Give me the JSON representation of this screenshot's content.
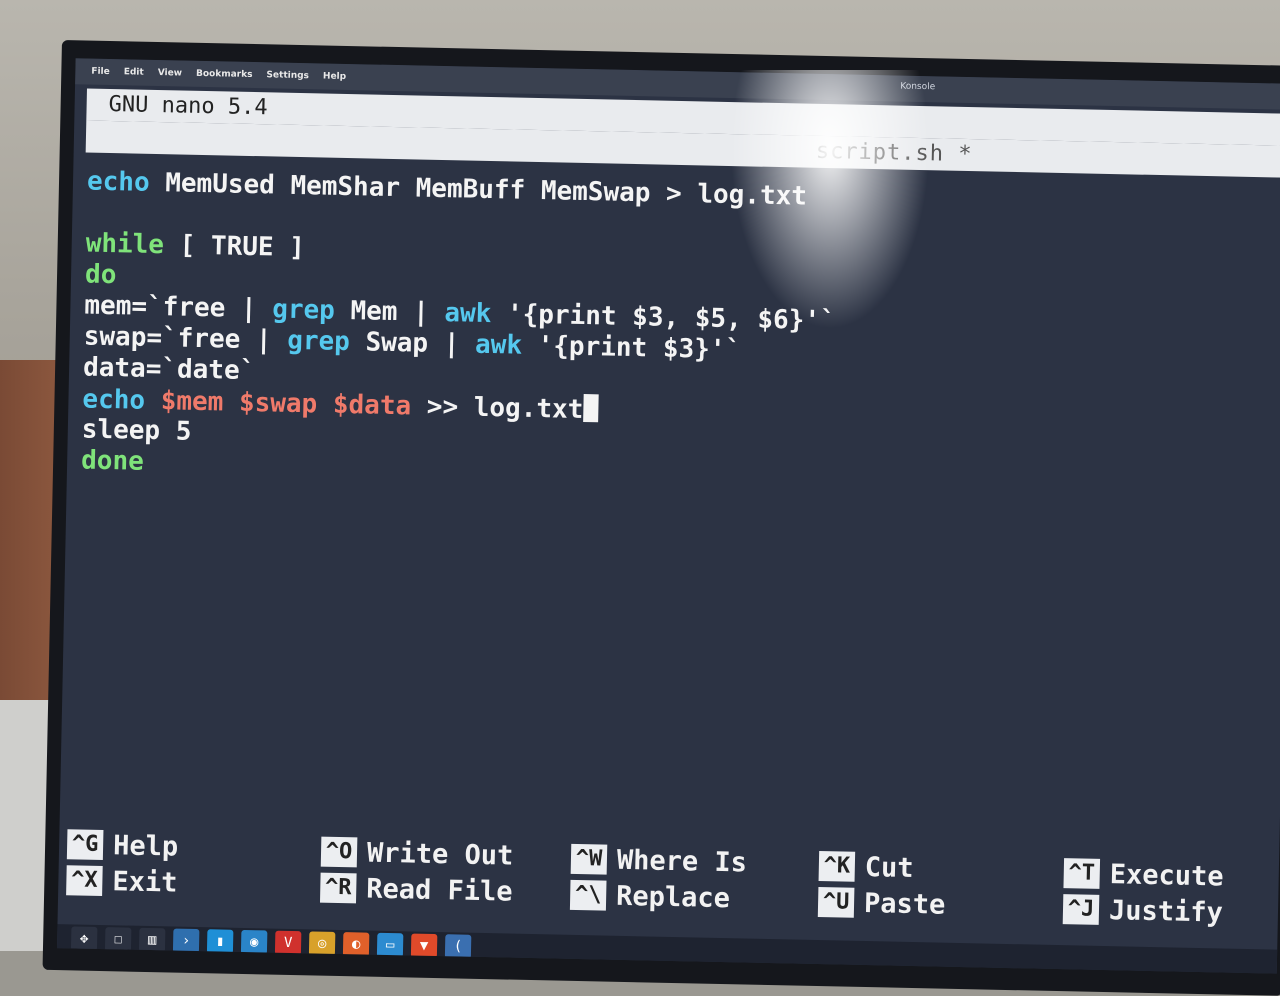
{
  "menu": {
    "items": [
      "File",
      "Edit",
      "View",
      "Bookmarks",
      "Settings",
      "Help"
    ],
    "window_title": "Konsole"
  },
  "title_bar": {
    "app_name": "GNU nano 5.4",
    "file_name": "script.sh *"
  },
  "editor": {
    "lines": [
      [
        {
          "t": "echo",
          "c": "kw"
        },
        {
          "t": " MemUsed MemShar MemBuff MemSwap > log.txt",
          "c": "wht"
        }
      ],
      [],
      [
        {
          "t": "while",
          "c": "ctl"
        },
        {
          "t": " [ TRUE ]",
          "c": "wht"
        }
      ],
      [
        {
          "t": "do",
          "c": "ctl"
        }
      ],
      [
        {
          "t": "mem=`free | ",
          "c": "wht"
        },
        {
          "t": "grep",
          "c": "kw"
        },
        {
          "t": " Mem | ",
          "c": "wht"
        },
        {
          "t": "awk",
          "c": "kw"
        },
        {
          "t": " '{print $3, $5, $6}'`",
          "c": "wht"
        }
      ],
      [
        {
          "t": "swap=`free | ",
          "c": "wht"
        },
        {
          "t": "grep",
          "c": "kw"
        },
        {
          "t": " Swap | ",
          "c": "wht"
        },
        {
          "t": "awk",
          "c": "kw"
        },
        {
          "t": " '{print $3}'`",
          "c": "wht"
        }
      ],
      [
        {
          "t": "data=`date`",
          "c": "wht"
        }
      ],
      [
        {
          "t": "echo",
          "c": "kw"
        },
        {
          "t": " ",
          "c": "wht"
        },
        {
          "t": "$mem",
          "c": "var"
        },
        {
          "t": " ",
          "c": "wht"
        },
        {
          "t": "$swap",
          "c": "var"
        },
        {
          "t": " ",
          "c": "wht"
        },
        {
          "t": "$data",
          "c": "var"
        },
        {
          "t": " >> log.txt",
          "c": "wht"
        }
      ],
      [
        {
          "t": "sleep 5",
          "c": "wht"
        }
      ],
      [
        {
          "t": "done",
          "c": "ctl"
        }
      ]
    ],
    "cursor_line": 7
  },
  "shortcuts": [
    {
      "key": "^G",
      "label": "Help"
    },
    {
      "key": "^X",
      "label": "Exit"
    },
    {
      "key": "^O",
      "label": "Write Out"
    },
    {
      "key": "^R",
      "label": "Read File"
    },
    {
      "key": "^W",
      "label": "Where Is"
    },
    {
      "key": "^\\",
      "label": "Replace"
    },
    {
      "key": "^K",
      "label": "Cut"
    },
    {
      "key": "^U",
      "label": "Paste"
    },
    {
      "key": "^T",
      "label": "Execute"
    },
    {
      "key": "^J",
      "label": "Justify"
    }
  ],
  "taskbar": {
    "icons": [
      {
        "name": "app-launcher-icon",
        "glyph": "✥",
        "color": "#2b3140"
      },
      {
        "name": "window-icon",
        "glyph": "☐",
        "color": "#2b3140"
      },
      {
        "name": "files-icon",
        "glyph": "▥",
        "color": "#2b3140"
      },
      {
        "name": "terminal-icon",
        "glyph": "›",
        "color": "#2f6fae"
      },
      {
        "name": "document-icon",
        "glyph": "▮",
        "color": "#1f8fd6"
      },
      {
        "name": "globe-icon",
        "glyph": "◉",
        "color": "#2a84c8"
      },
      {
        "name": "vivaldi-icon",
        "glyph": "V",
        "color": "#d0312d"
      },
      {
        "name": "chrome-icon",
        "glyph": "◎",
        "color": "#d8a12a"
      },
      {
        "name": "firefox-icon",
        "glyph": "◐",
        "color": "#e0602a"
      },
      {
        "name": "folder-icon",
        "glyph": "▭",
        "color": "#2c8bd0"
      },
      {
        "name": "brave-icon",
        "glyph": "▼",
        "color": "#e04a2a"
      },
      {
        "name": "partial-icon",
        "glyph": "(",
        "color": "#3a6fb0"
      }
    ]
  }
}
